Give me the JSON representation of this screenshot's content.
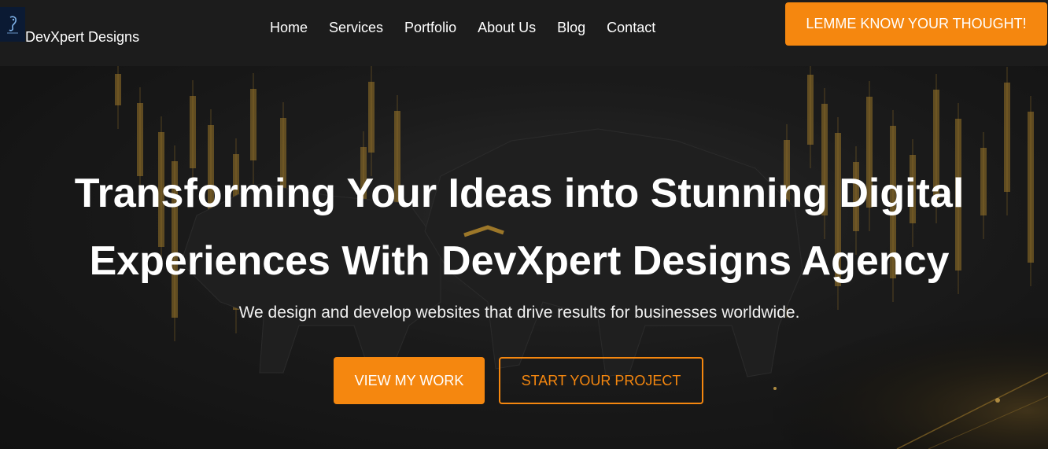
{
  "header": {
    "brand": "DevXpert Designs",
    "nav": [
      "Home",
      "Services",
      "Portfolio",
      "About Us",
      "Blog",
      "Contact"
    ],
    "cta": "LEMME KNOW YOUR THOUGHT!"
  },
  "hero": {
    "title_line1": "Transforming Your Ideas into Stunning Digital",
    "title_line2": "Experiences With DevXpert Designs Agency",
    "subtitle": "We design and develop websites that drive results for businesses worldwide.",
    "primary_button": "VIEW MY WORK",
    "secondary_button": "START YOUR PROJECT"
  },
  "colors": {
    "accent": "#f5870f",
    "header_bg": "#1c1c1c",
    "hero_bg": "#262626",
    "candle_gold": "#d9a53a"
  },
  "icons": {
    "logo": "bull-logo-icon",
    "hero_image": "bull-candlestick-background"
  }
}
